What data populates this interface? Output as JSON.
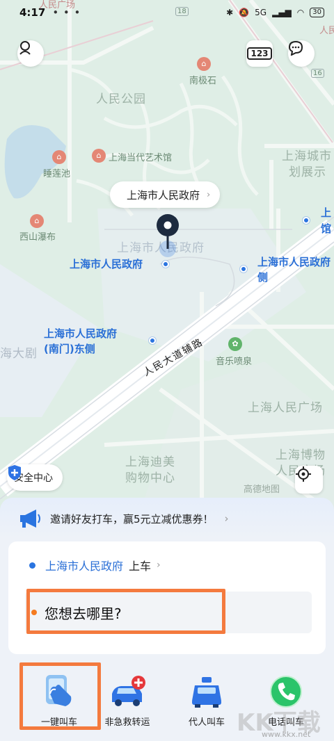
{
  "status_bar": {
    "time": "4:17",
    "dots": "• • •",
    "network": "5G",
    "battery": "30"
  },
  "map": {
    "top_labels": [
      "人民广场",
      "人民"
    ],
    "road_numbers": [
      "18",
      "16"
    ],
    "area_labels": {
      "park": "人民公园",
      "gov_watermark": "上海市人民政府",
      "city_planning_1": "上海城市",
      "city_planning_2": "划展示",
      "opera": "海大剧",
      "people_square": "上海人民广场",
      "dimei_1": "上海迪美",
      "dimei_2": "购物中心",
      "museum_1": "上海博物",
      "museum_2": "人民广场"
    },
    "poi_labels": {
      "nanjiao": "南极石",
      "lotus": "睡莲池",
      "moca": "上海当代艺术馆",
      "waterfall": "西山瀑布",
      "fountain": "音乐喷泉"
    },
    "road_name": "人民大道辅路",
    "blue_labels": {
      "gov": "上海市人民政府",
      "gov_side_1": "上海市人民政府",
      "gov_side_2": "侧",
      "south_gate_1": "上海市人民政府",
      "south_gate_2": "(南门)东侧",
      "edge_1": "上",
      "edge_2": "馆"
    },
    "pickup_bubble": "上海市人民政府",
    "safety_center": "安全中心",
    "brand": "高德地图",
    "traffic_button": "123"
  },
  "promo": {
    "text": "邀请好友打车，赢5元立减优惠券！"
  },
  "ride_card": {
    "pickup_name": "上海市人民政府",
    "pickup_suffix": "上车",
    "destination_placeholder": "您想去哪里?"
  },
  "services": [
    {
      "label": "一键叫车",
      "icon": "one-tap-hail-icon"
    },
    {
      "label": "非急救转运",
      "icon": "ambulance-icon"
    },
    {
      "label": "代人叫车",
      "icon": "taxi-icon"
    },
    {
      "label": "电话叫车",
      "icon": "phone-icon"
    }
  ],
  "watermark": {
    "text": "KK下载",
    "url": "www.kkx.net"
  },
  "colors": {
    "accent_blue": "#2a74e0",
    "highlight_orange": "#f47a3e",
    "map_green": "#dfeee6"
  }
}
